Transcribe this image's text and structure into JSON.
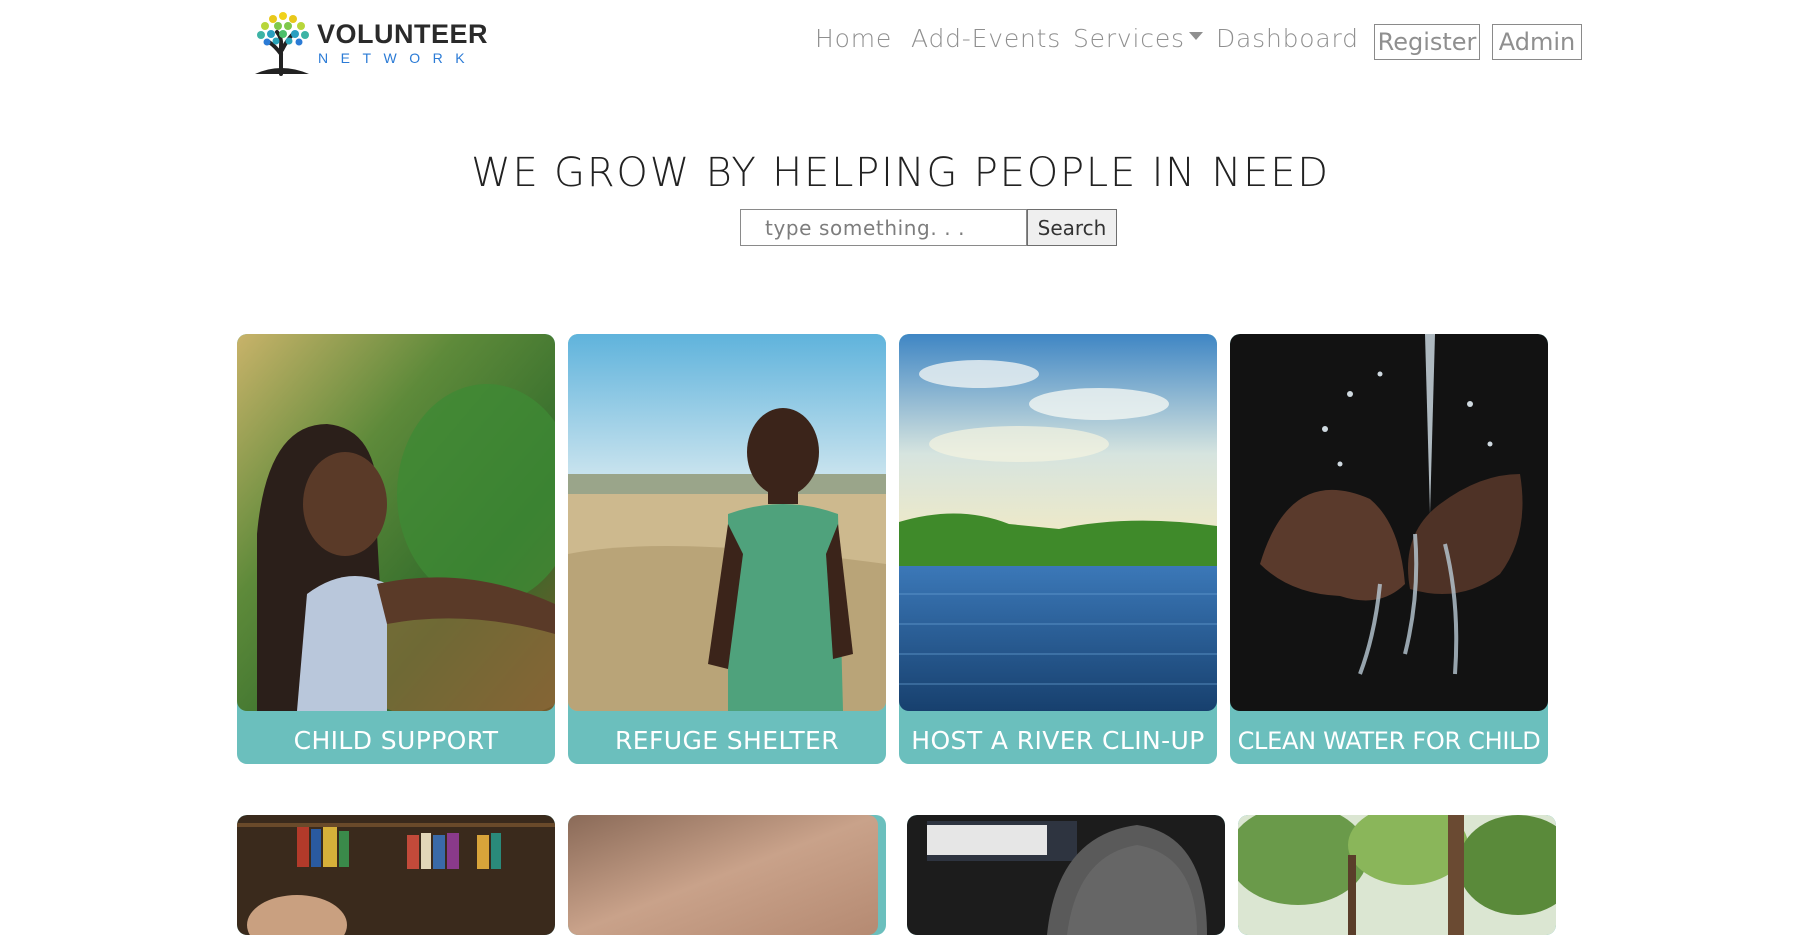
{
  "brand": {
    "title": "VOLUNTEER",
    "subtitle": "NETWORK",
    "logo_icon": "tree-logo-icon"
  },
  "nav": {
    "home": "Home",
    "add_events": "Add-Events",
    "services": "Services",
    "dashboard": "Dashboard",
    "register": "Register",
    "admin": "Admin"
  },
  "hero": {
    "title": "WE GROW BY HELPING PEOPLE IN NEED",
    "search_placeholder": "type something. . .",
    "search_button": "Search"
  },
  "cards": [
    {
      "label": "CHILD SUPPORT",
      "image": "girl-in-park-photo"
    },
    {
      "label": "REFUGE SHELTER",
      "image": "boy-in-field-photo"
    },
    {
      "label": "HOST A RIVER CLIN-UP",
      "image": "river-landscape-photo"
    },
    {
      "label": "CLEAN WATER FOR CHILD",
      "image": "hands-with-water-photo"
    },
    {
      "label": "",
      "image": "bookshelf-photo"
    },
    {
      "label": "",
      "image": "blurred-skin-photo"
    },
    {
      "label": "",
      "image": "person-at-laptop-photo"
    },
    {
      "label": "",
      "image": "forest-photo"
    }
  ],
  "colors": {
    "card_accent": "#6bbfbd",
    "logo_blue": "#2b7bd6",
    "nav_text": "#8f8f8f"
  }
}
